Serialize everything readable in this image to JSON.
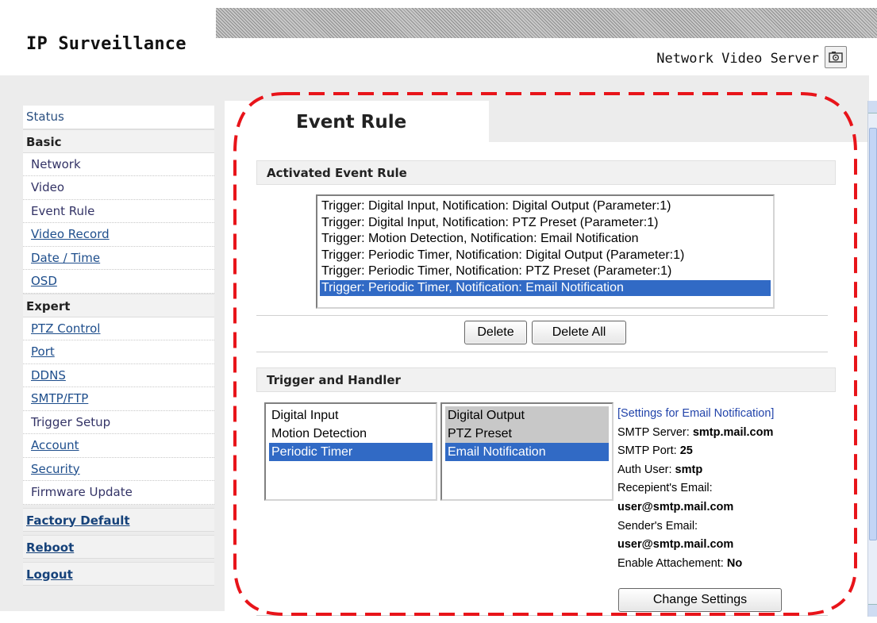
{
  "header": {
    "app_title": "IP Surveillance",
    "product_name": "Network Video Server",
    "camera_icon": "camera-icon"
  },
  "sidebar": {
    "status": "Status",
    "basic_heading": "Basic",
    "basic_items": [
      "Network",
      "Video",
      "Event Rule",
      "Video Record",
      "Date / Time",
      "OSD"
    ],
    "expert_heading": "Expert",
    "expert_items": [
      "PTZ Control",
      "Port",
      "DDNS",
      "SMTP/FTP",
      "Trigger Setup",
      "Account",
      "Security",
      "Firmware Update"
    ],
    "factory_default": "Factory Default",
    "reboot": "Reboot",
    "logout": "Logout"
  },
  "page": {
    "title": "Event Rule"
  },
  "activated": {
    "heading": "Activated Event Rule",
    "rules": [
      "Trigger: Digital Input, Notification: Digital Output (Parameter:1)",
      "Trigger: Digital Input, Notification: PTZ Preset (Parameter:1)",
      "Trigger: Motion Detection, Notification: Email Notification",
      "Trigger: Periodic Timer, Notification: Digital Output (Parameter:1)",
      "Trigger: Periodic Timer, Notification: PTZ Preset (Parameter:1)",
      "Trigger: Periodic Timer, Notification: Email Notification"
    ],
    "selected_rule": "Trigger: Periodic Timer, Notification: Email Notification",
    "delete_label": "Delete",
    "delete_all_label": "Delete All"
  },
  "trigger_handler": {
    "heading": "Trigger and Handler",
    "triggers": [
      "Digital Input",
      "Motion Detection",
      "Periodic Timer"
    ],
    "selected_trigger": "Periodic Timer",
    "handlers": [
      "Digital Output",
      "PTZ Preset",
      "Email Notification"
    ],
    "selected_handler": "Email Notification",
    "settings_heading": "[Settings for Email Notification]",
    "smtp_server_label": "SMTP Server: ",
    "smtp_server_value": "smtp.mail.com",
    "smtp_port_label": "SMTP Port: ",
    "smtp_port_value": "25",
    "auth_user_label": "Auth User: ",
    "auth_user_value": "smtp",
    "recipient_label": "Recepient's Email:",
    "recipient_value": "user@smtp.mail.com",
    "sender_label": "Sender's Email:",
    "sender_value": "user@smtp.mail.com",
    "attachment_label": "Enable Attachement: ",
    "attachment_value": "No",
    "change_settings_label": "Change Settings"
  },
  "colors": {
    "selection": "#316ac5",
    "annotation": "#e8141a",
    "link": "#1e4e8c"
  }
}
